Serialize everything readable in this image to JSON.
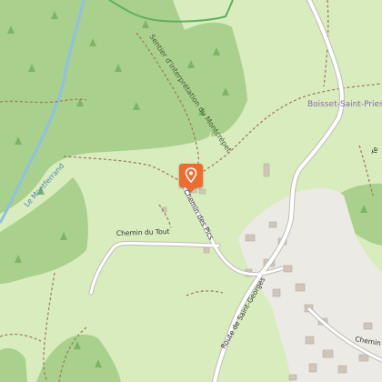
{
  "map": {
    "colors": {
      "meadow": "#d9ecbd",
      "forest": "#a9d08c",
      "village": "#eceae4",
      "road": "#ffffff",
      "road_casing": "#bdbdb8",
      "trail": "#a0805a",
      "river": "#8fc1e3",
      "boundary": "#5fb05c",
      "building": "#cfc6bb",
      "marker": "#ee6c2f"
    },
    "labels": {
      "trail": "Sentier d'interprétation du Montcrépet",
      "village": "Boisset-Saint-Priest",
      "river": "Le Montferrand",
      "chemin_pics": "Chemin des Pics",
      "chemin_tout": "Chemin du Tout",
      "route": "Route de Saint-Georges",
      "chemin_sw": "Chemin d",
      "right_edge": "Te"
    },
    "marker": {
      "icon": "map-pin-icon",
      "kind": "point of interest"
    }
  }
}
